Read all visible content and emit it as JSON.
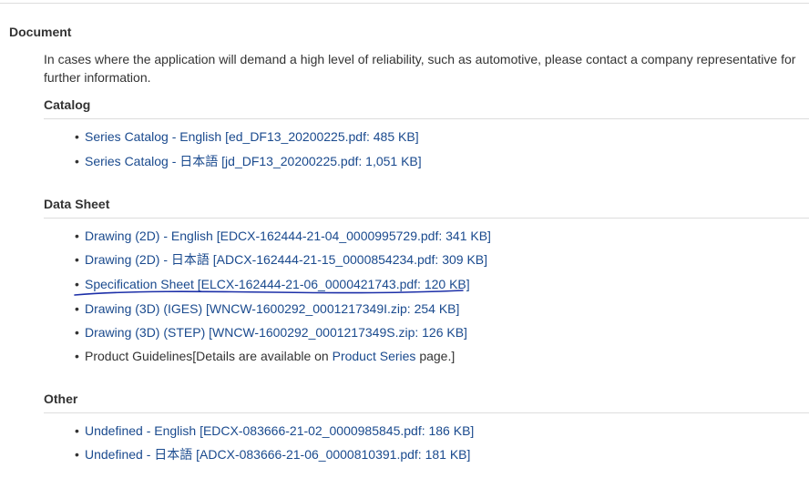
{
  "document": {
    "heading": "Document",
    "notice": "In cases where the application will demand a high level of reliability, such as automotive, please contact a company representative for further information."
  },
  "catalog": {
    "heading": "Catalog",
    "items": [
      "Series Catalog - English [ed_DF13_20200225.pdf: 485 KB]",
      "Series Catalog - 日本語 [jd_DF13_20200225.pdf: 1,051 KB]"
    ]
  },
  "data_sheet": {
    "heading": "Data Sheet",
    "items": [
      "Drawing (2D) - English [EDCX-162444-21-04_0000995729.pdf: 341 KB]",
      "Drawing (2D) - 日本語 [ADCX-162444-21-15_0000854234.pdf: 309 KB]",
      "Specification Sheet [ELCX-162444-21-06_0000421743.pdf: 120 KB]",
      "Drawing (3D) (IGES) [WNCW-1600292_0001217349I.zip: 254 KB]",
      "Drawing (3D) (STEP) [WNCW-1600292_0001217349S.zip: 126 KB]"
    ],
    "guidelines": {
      "prefix": "Product Guidelines[Details are available on ",
      "link": "Product Series",
      "suffix": " page.]"
    }
  },
  "other": {
    "heading": "Other",
    "items": [
      "Undefined - English [EDCX-083666-21-02_0000985845.pdf: 186 KB]",
      "Undefined - 日本語 [ADCX-083666-21-06_0000810391.pdf: 181 KB]"
    ]
  },
  "colors": {
    "link": "#1a4a8e",
    "text": "#333333",
    "rule": "#dddddd",
    "annotation": "#1c2fa8"
  },
  "icons": {
    "bullet": "bullet-icon"
  }
}
